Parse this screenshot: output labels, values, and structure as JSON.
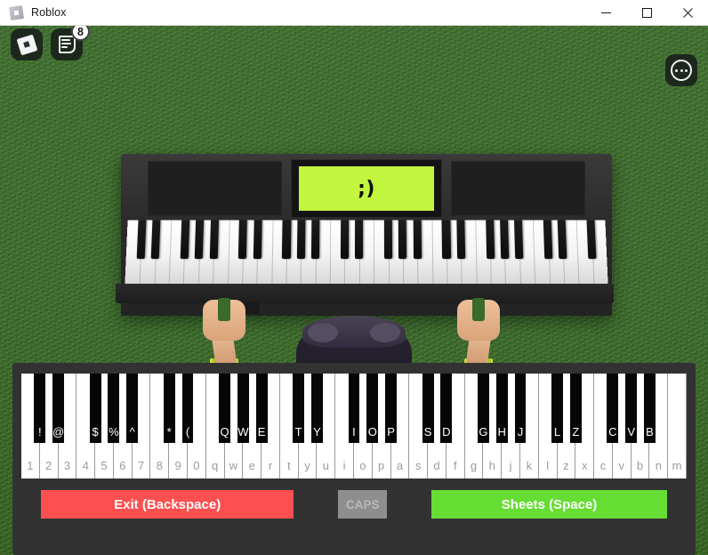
{
  "window": {
    "title": "Roblox",
    "icon": "roblox-logo-icon",
    "controls": {
      "minimize": "minimize-icon",
      "maximize": "maximize-icon",
      "close": "close-icon"
    }
  },
  "hud": {
    "roblox_button": "roblox-menu-icon",
    "chat_button": "chat-log-icon",
    "chat_badge": "8",
    "more_button": "more-options-icon"
  },
  "scene": {
    "background": "grass-field",
    "grass_color": "#3a6a2c",
    "piano": {
      "body_color": "#2c2c2c",
      "lcd_text": ";)",
      "lcd_color": "#c2f53d",
      "lcd_text_color": "#0d0d0d"
    },
    "avatar": {
      "skin_color": "#e0ad83",
      "sleeve_color": "#7ccd22",
      "shirt_color": "#241f2d",
      "hair_color": "#3d3649"
    }
  },
  "virtual_keyboard": {
    "panel_color": "#323232",
    "white_keys": [
      "1",
      "2",
      "3",
      "4",
      "5",
      "6",
      "7",
      "8",
      "9",
      "0",
      "q",
      "w",
      "e",
      "r",
      "t",
      "y",
      "u",
      "i",
      "o",
      "p",
      "a",
      "s",
      "d",
      "f",
      "g",
      "h",
      "j",
      "k",
      "l",
      "z",
      "x",
      "c",
      "v",
      "b",
      "n",
      "m"
    ],
    "black_keys": [
      {
        "label": "!",
        "after": 0
      },
      {
        "label": "@",
        "after": 1
      },
      {
        "label": "$",
        "after": 3
      },
      {
        "label": "%",
        "after": 4
      },
      {
        "label": "^",
        "after": 5
      },
      {
        "label": "*",
        "after": 7
      },
      {
        "label": "(",
        "after": 8
      },
      {
        "label": "Q",
        "after": 10
      },
      {
        "label": "W",
        "after": 11
      },
      {
        "label": "E",
        "after": 12
      },
      {
        "label": "T",
        "after": 14
      },
      {
        "label": "Y",
        "after": 15
      },
      {
        "label": "I",
        "after": 17
      },
      {
        "label": "O",
        "after": 18
      },
      {
        "label": "P",
        "after": 19
      },
      {
        "label": "S",
        "after": 21
      },
      {
        "label": "D",
        "after": 22
      },
      {
        "label": "G",
        "after": 24
      },
      {
        "label": "H",
        "after": 25
      },
      {
        "label": "J",
        "after": 26
      },
      {
        "label": "L",
        "after": 28
      },
      {
        "label": "Z",
        "after": 29
      },
      {
        "label": "C",
        "after": 31
      },
      {
        "label": "V",
        "after": 32
      },
      {
        "label": "B",
        "after": 33
      }
    ],
    "buttons": {
      "exit": {
        "label": "Exit (Backspace)",
        "color": "#fc4f4f",
        "enabled": true
      },
      "caps": {
        "label": "CAPS",
        "color": "#8e8e8e",
        "enabled": false
      },
      "sheets": {
        "label": "Sheets (Space)",
        "color": "#66dd33",
        "enabled": true
      }
    }
  }
}
